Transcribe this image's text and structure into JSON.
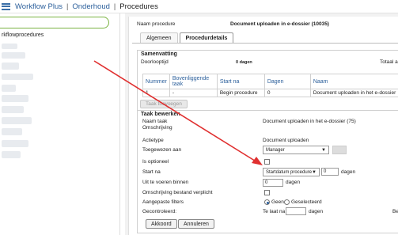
{
  "breadcrumb": {
    "items": [
      "Workflow Plus",
      "Onderhoud",
      "Procedures"
    ]
  },
  "sidebar": {
    "title": "rkflowprocedures"
  },
  "header": {
    "name_label": "Naam procedure",
    "name_value": "Document uploaden in e-dossier (10035)"
  },
  "tabs": [
    {
      "label": "Algemeen"
    },
    {
      "label": "Procedurdetails"
    }
  ],
  "summary": {
    "title": "Samenvatting",
    "lead_time_label": "Doorlooptijd",
    "lead_time_value": "0 dagen",
    "total_label": "Totaal a"
  },
  "steps_table": {
    "headers": [
      "Nummer",
      "Bovenliggende taak",
      "Start na",
      "Dagen",
      "Naam"
    ],
    "rows": [
      [
        "1",
        "-",
        "Begin procedure",
        "0",
        "Document uploaden in het e-dossier"
      ]
    ]
  },
  "add_task_button": "Taak toevoegen",
  "edit": {
    "title": "Taak bewerken",
    "task_name_label": "Naam taak",
    "task_name_value": "Document uploaden in het e-dossier (75)",
    "description_label": "Omschrijving",
    "action_type_label": "Actietype",
    "action_type_value": "Document uploaden",
    "assigned_label": "Toegewezen aan",
    "assigned_value": "Manager",
    "optional_label": "Is optioneel",
    "start_after_label": "Start na",
    "start_after_value": "Startdatum procedure",
    "start_after_days": "0",
    "days_unit": "dagen",
    "within_label": "Uit te voeren binnen",
    "within_value": "0",
    "desc_required_label": "Omschrijving bestand verplicht",
    "custom_filters_label": "Aangepaste filters",
    "radio_none": "Geen",
    "radio_selected": "Geselecteerd",
    "checked_label": "Gecontroleerd:",
    "late_label": "Te laat na",
    "late_value": "",
    "late_unit": "dagen",
    "right_cut": "Be",
    "approve_button": "Akkoord",
    "cancel_button": "Annuleren"
  },
  "colors": {
    "accent": "#2b5f9b",
    "arrow": "#e03030",
    "search_border": "#7bb342"
  }
}
